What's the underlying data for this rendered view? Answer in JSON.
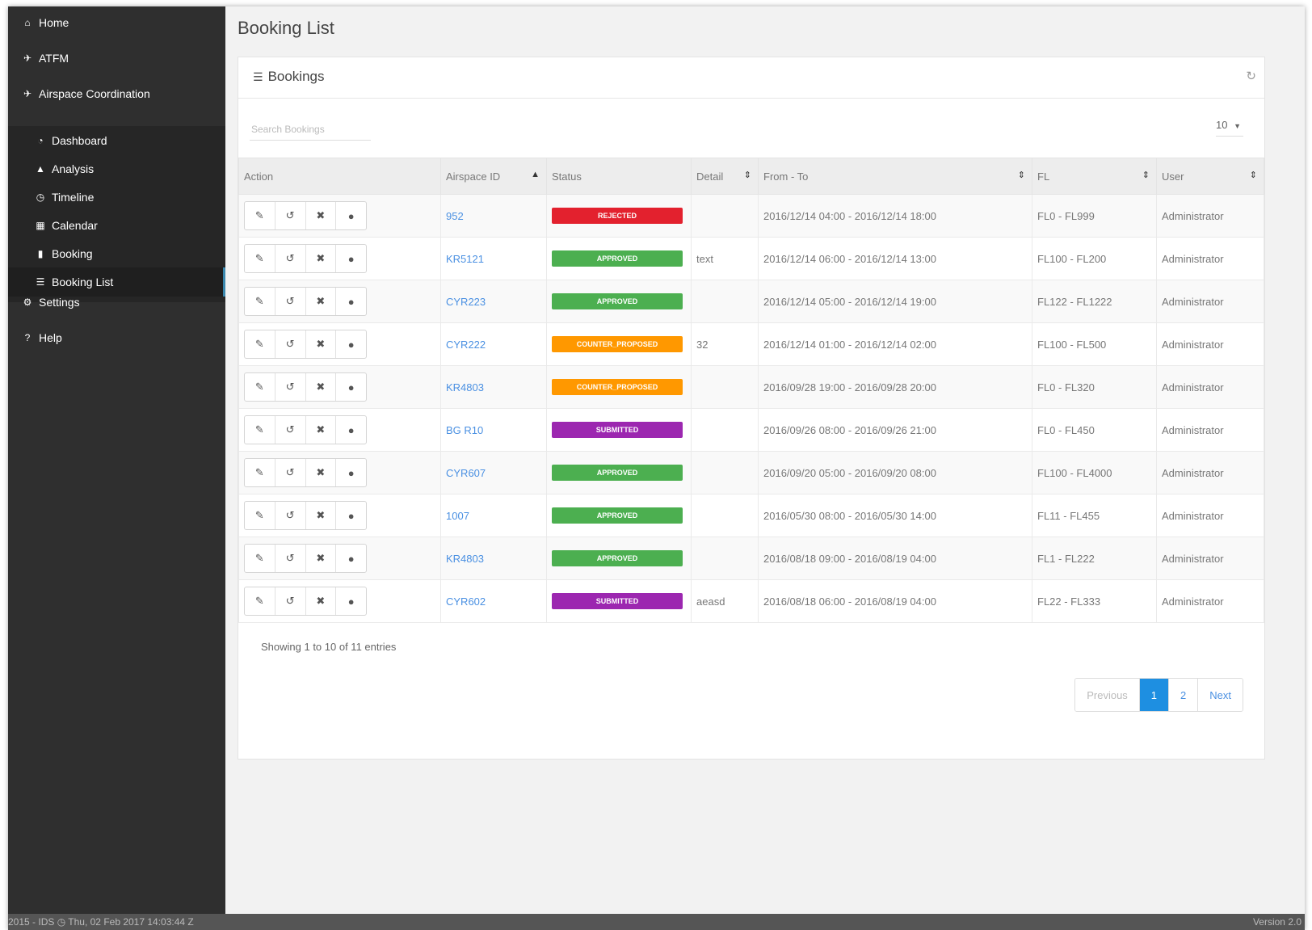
{
  "sidebar": {
    "items": [
      {
        "label": "Home",
        "icon": "home-icon"
      },
      {
        "label": "ATFM",
        "icon": "plane-icon"
      },
      {
        "label": "Airspace Coordination",
        "icon": "airspace-icon"
      }
    ],
    "submenu": [
      {
        "label": "Dashboard",
        "icon": "dashboard-icon"
      },
      {
        "label": "Analysis",
        "icon": "area-chart-icon"
      },
      {
        "label": "Timeline",
        "icon": "clock-icon"
      },
      {
        "label": "Calendar",
        "icon": "calendar-icon"
      },
      {
        "label": "Booking",
        "icon": "book-icon"
      },
      {
        "label": "Booking List",
        "icon": "list-icon"
      }
    ],
    "bottom_items": [
      {
        "label": "Settings",
        "icon": "gear-icon"
      },
      {
        "label": "Help",
        "icon": "question-icon"
      }
    ]
  },
  "page": {
    "title": "Booking List"
  },
  "panel": {
    "title": "Bookings"
  },
  "search": {
    "placeholder": "Search Bookings"
  },
  "page_size": {
    "value": "10"
  },
  "table": {
    "columns": [
      "Action",
      "Airspace ID",
      "Status",
      "Detail",
      "From - To",
      "FL",
      "User"
    ],
    "rows": [
      {
        "airspace_id": "952",
        "status": "REJECTED",
        "detail": "",
        "from_to": "2016/12/14 04:00 - 2016/12/14 18:00",
        "fl": "FL0 - FL999",
        "user": "Administrator"
      },
      {
        "airspace_id": "KR5121",
        "status": "APPROVED",
        "detail": "text",
        "from_to": "2016/12/14 06:00 - 2016/12/14 13:00",
        "fl": "FL100 - FL200",
        "user": "Administrator"
      },
      {
        "airspace_id": "CYR223",
        "status": "APPROVED",
        "detail": "",
        "from_to": "2016/12/14 05:00 - 2016/12/14 19:00",
        "fl": "FL122 - FL1222",
        "user": "Administrator"
      },
      {
        "airspace_id": "CYR222",
        "status": "COUNTER_PROPOSED",
        "detail": "32",
        "from_to": "2016/12/14 01:00 - 2016/12/14 02:00",
        "fl": "FL100 - FL500",
        "user": "Administrator"
      },
      {
        "airspace_id": "KR4803",
        "status": "COUNTER_PROPOSED",
        "detail": "",
        "from_to": "2016/09/28 19:00 - 2016/09/28 20:00",
        "fl": "FL0 - FL320",
        "user": "Administrator"
      },
      {
        "airspace_id": "BG R10",
        "status": "SUBMITTED",
        "detail": "",
        "from_to": "2016/09/26 08:00 - 2016/09/26 21:00",
        "fl": "FL0 - FL450",
        "user": "Administrator"
      },
      {
        "airspace_id": "CYR607",
        "status": "APPROVED",
        "detail": "",
        "from_to": "2016/09/20 05:00 - 2016/09/20 08:00",
        "fl": "FL100 - FL4000",
        "user": "Administrator"
      },
      {
        "airspace_id": "1007",
        "status": "APPROVED",
        "detail": "",
        "from_to": "2016/05/30 08:00 - 2016/05/30 14:00",
        "fl": "FL11 - FL455",
        "user": "Administrator"
      },
      {
        "airspace_id": "KR4803",
        "status": "APPROVED",
        "detail": "",
        "from_to": "2016/08/18 09:00 - 2016/08/19 04:00",
        "fl": "FL1 - FL222",
        "user": "Administrator"
      },
      {
        "airspace_id": "CYR602",
        "status": "SUBMITTED",
        "detail": "aeasd",
        "from_to": "2016/08/18 06:00 - 2016/08/19 04:00",
        "fl": "FL22 - FL333",
        "user": "Administrator"
      }
    ]
  },
  "status_colors": {
    "REJECTED": "#e3212e",
    "APPROVED": "#4caf50",
    "COUNTER_PROPOSED": "#ff9800",
    "SUBMITTED": "#9c27b0"
  },
  "action_icons": [
    "edit-icon",
    "undo-icon",
    "delete-icon",
    "globe-icon"
  ],
  "footer": {
    "info": "Showing 1 to 10 of 11 entries"
  },
  "pagination": {
    "previous": "Previous",
    "pages": [
      "1",
      "2"
    ],
    "current": "1",
    "next": "Next"
  },
  "bottom_bar": {
    "left": "2015 - IDS ◷ Thu, 02 Feb 2017 14:03:44 Z",
    "right": "Version 2.0"
  }
}
